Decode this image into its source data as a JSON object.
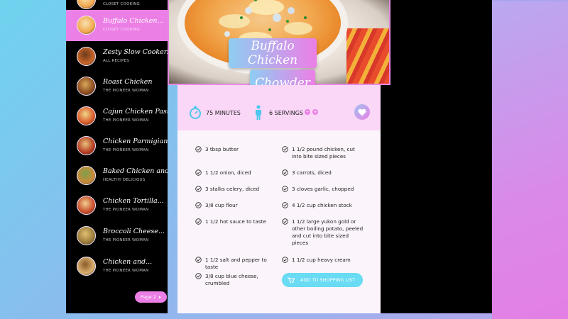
{
  "recipe": {
    "title_line1": "Buffalo Chicken",
    "title_line2": "Chowder",
    "minutes": "75 MINUTES",
    "servings": "6 SERVINGS",
    "minus": "−",
    "plus": "+",
    "shopping_button": "ADD TO SHOPPING LIST"
  },
  "sidebar": {
    "items": [
      {
        "title": "",
        "subtitle": "CLOSET COOKING"
      },
      {
        "title": "Buffalo Chicken...",
        "subtitle": "CLOSET COOKING"
      },
      {
        "title": "Zesty Slow Cooker...",
        "subtitle": "ALL RECIPES"
      },
      {
        "title": "Roast Chicken",
        "subtitle": "THE PIONEER WOMAN"
      },
      {
        "title": "Cajun Chicken Pasta...",
        "subtitle": "THE PIONEER WOMAN"
      },
      {
        "title": "Chicken Parmigiana...",
        "subtitle": "THE PIONEER WOMAN"
      },
      {
        "title": "Baked Chicken and...",
        "subtitle": "HEALTHY DELICIOUS"
      },
      {
        "title": "Chicken Tortilla...",
        "subtitle": "THE PIONEER WOMAN"
      },
      {
        "title": "Broccoli Cheese...",
        "subtitle": "THE PIONEER WOMAN"
      },
      {
        "title": "Chicken and...",
        "subtitle": "THE PIONEER WOMAN"
      }
    ],
    "page_button": "Page 2"
  },
  "ingredients": {
    "left": [
      "3 tbsp butter",
      "1 1/2 onion, diced",
      "3 stalks celery, diced",
      "3/8 cup flour",
      "1 1/2 hot sauce to taste",
      "1 1/2 salt and pepper to taste",
      "3/8 cup blue cheese, crumbled"
    ],
    "right": [
      "1 1/2 pound chicken, cut into bite sized pieces",
      "3 carrots, diced",
      "3 cloves garlic, chopped",
      "4 1/2 cup chicken stock",
      "1 1/2 large yukon gold or other boiling potato, peeled and cut into bite sized pieces",
      "1 1/2 cup heavy cream"
    ]
  },
  "colors": {
    "accent_pink": "#ec7fe6",
    "accent_cyan": "#69dbf3",
    "stats_band": "#fad6f7",
    "sidebar_bg": "#000000"
  },
  "icons": [
    "stopwatch-icon",
    "person-icon",
    "heart-icon",
    "check-circle-icon",
    "cart-icon",
    "arrow-right-icon"
  ]
}
